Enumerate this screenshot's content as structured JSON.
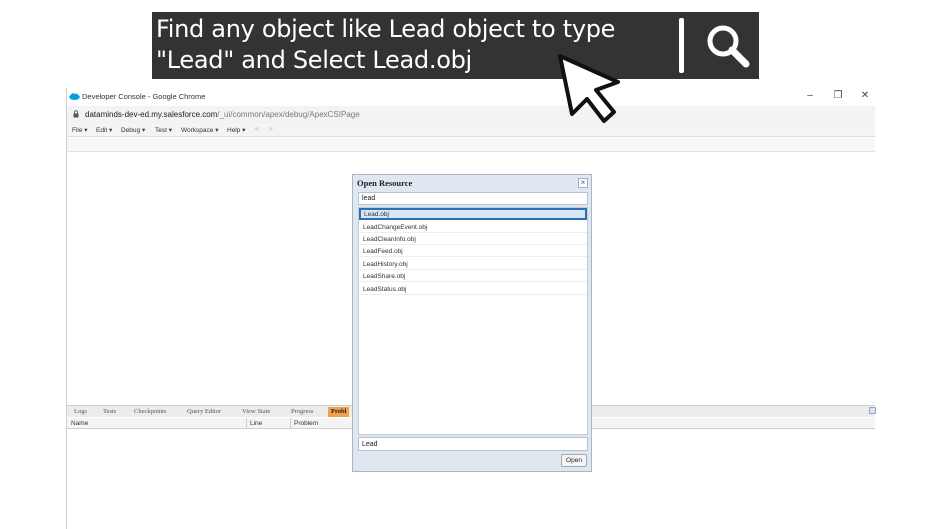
{
  "banner": {
    "line1": "Find any object like Lead object to type",
    "line2": "\"Lead\" and Select Lead.obj"
  },
  "browser": {
    "window_title": "Developer Console - Google Chrome",
    "url_host": "dataminds-dev-ed.my.salesforce.com",
    "url_path": "/_ui/common/apex/debug/ApexCSIPage",
    "controls": {
      "minimize": "–",
      "restore": "❐",
      "close": "✕"
    }
  },
  "menu": {
    "items": [
      "File ▾",
      "Edit ▾",
      "Debug ▾",
      "Test ▾",
      "Workspace ▾",
      "Help ▾"
    ],
    "back": "<",
    "forward": ">"
  },
  "bottom_panel": {
    "tabs": [
      "Logs",
      "Tests",
      "Checkpoints",
      "Query Editor",
      "View State",
      "Progress",
      "Probl"
    ],
    "active_tab": "Probl",
    "columns": [
      "Name",
      "Line",
      "Problem"
    ]
  },
  "dialog": {
    "title": "Open Resource",
    "close": "×",
    "search_value": "lead",
    "results": [
      "Lead.obj",
      "LeadChangeEvent.obj",
      "LeadCleanInfo.obj",
      "LeadFeed.obj",
      "LeadHistory.obj",
      "LeadShare.obj",
      "LeadStatus.obj"
    ],
    "selected_index": 0,
    "name_value": "Lead",
    "open_label": "Open"
  },
  "icons": {
    "banner_search": "search-icon",
    "cursor": "mouse-pointer-icon",
    "salesforce_logo": "salesforce-cloud-icon",
    "lock": "lock-icon"
  },
  "colors": {
    "banner_bg": "#333333",
    "selection_border": "#2f6fb3",
    "active_tab": "#f0a24a",
    "salesforce_blue": "#00a1e0"
  }
}
